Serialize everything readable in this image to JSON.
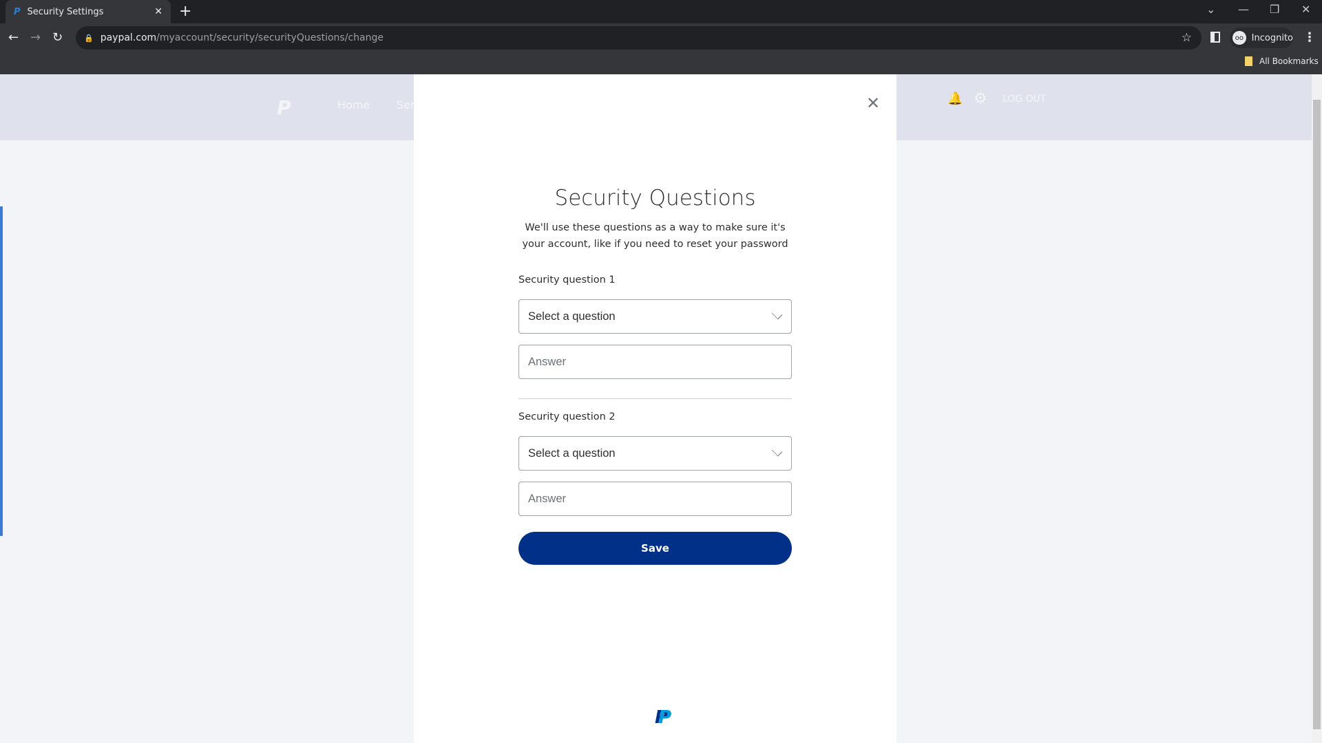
{
  "browser": {
    "tab_title": "Security Settings",
    "url_host": "paypal.com",
    "url_path": "/myaccount/security/securityQuestions/change",
    "profile": "Incognito",
    "bookmarks_label": "All Bookmarks"
  },
  "header": {
    "nav": [
      "Home",
      "Ser"
    ],
    "logout": "LOG OUT"
  },
  "modal": {
    "title": "Security Questions",
    "subtitle": "We'll use these questions as a way to make sure it's your account, like if you need to reset your password",
    "questions": [
      {
        "label": "Security question 1",
        "select_value": "Select a question",
        "answer_placeholder": "Answer"
      },
      {
        "label": "Security question 2",
        "select_value": "Select a question",
        "answer_placeholder": "Answer"
      }
    ],
    "save_label": "Save"
  },
  "colors": {
    "primary": "#003087",
    "accent": "#009cde",
    "header_bg": "#dfe2ec"
  }
}
